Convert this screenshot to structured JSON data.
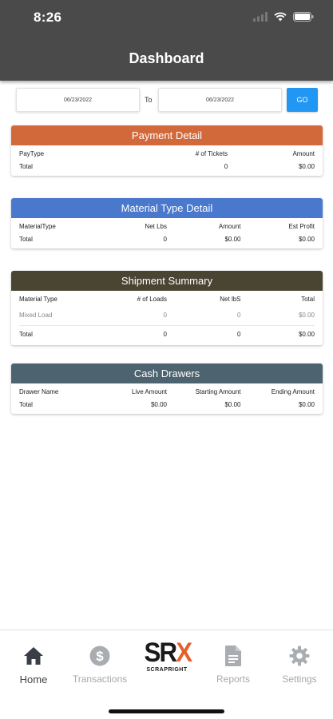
{
  "status_bar": {
    "time": "8:26"
  },
  "header": {
    "title": "Dashboard"
  },
  "date_filter": {
    "from": "06/23/2022",
    "to_label": "To",
    "to": "06/23/2022",
    "go_label": "GO"
  },
  "payment_detail": {
    "title": "Payment Detail",
    "columns": [
      "PayType",
      "# of Tickets",
      "Amount"
    ],
    "total_row": [
      "Total",
      "0",
      "$0.00"
    ]
  },
  "material_type_detail": {
    "title": "Material Type Detail",
    "columns": [
      "MaterialType",
      "Net Lbs",
      "Amount",
      "Est Profit"
    ],
    "total_row": [
      "Total",
      "0",
      "$0.00",
      "$0.00"
    ]
  },
  "shipment_summary": {
    "title": "Shipment Summary",
    "columns": [
      "Material Type",
      "# of Loads",
      "Net lbS",
      "Total"
    ],
    "rows": [
      [
        "Mixed Load",
        "0",
        "0",
        "$0.00"
      ]
    ],
    "total_row": [
      "Total",
      "0",
      "0",
      "$0.00"
    ]
  },
  "cash_drawers": {
    "title": "Cash Drawers",
    "columns": [
      "Drawer Name",
      "Live Amount",
      "Starting Amount",
      "Ending Amount"
    ],
    "total_row": [
      "Total",
      "$0.00",
      "$0.00",
      "$0.00"
    ]
  },
  "bottom_nav": {
    "items": [
      {
        "label": "Home",
        "icon": "home-icon",
        "active": true
      },
      {
        "label": "Transactions",
        "icon": "dollar-icon",
        "active": false
      },
      {
        "label": "Reports",
        "icon": "document-icon",
        "active": false
      },
      {
        "label": "Settings",
        "icon": "gear-icon",
        "active": false
      }
    ],
    "logo": {
      "main_s": "S",
      "main_r": "R",
      "main_x": "X",
      "sub": "SCRAPRIGHT"
    }
  },
  "colors": {
    "header": "#4a4a4a",
    "payment": "#d2693b",
    "material": "#4a78cc",
    "shipment": "#4a4533",
    "cash": "#4d6470",
    "go_button": "#2196f3",
    "logo_accent": "#e4602e"
  }
}
